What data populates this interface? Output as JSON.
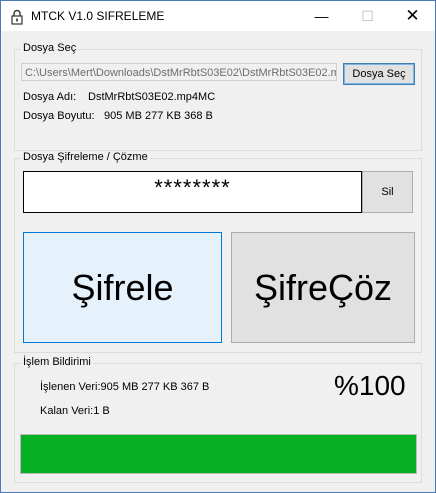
{
  "window": {
    "title": "MTCK V1.0 SIFRELEME",
    "controls": {
      "minimize": "—",
      "maximize": "☐",
      "close": "✕"
    }
  },
  "file_select": {
    "group_label": "Dosya Seç",
    "path_value": "C:\\Users\\Mert\\Downloads\\DstMrRbtS03E02\\DstMrRbtS03E02.m",
    "button_label": "Dosya Seç",
    "name_label": "Dosya Adı:",
    "name_value": "DstMrRbtS03E02.mp4MC",
    "size_label": "Dosya Boyutu:",
    "size_value": "905 MB 277 KB 368 B"
  },
  "crypto": {
    "group_label": "Dosya Şifreleme / Çözme",
    "password_value": "********",
    "clear_label": "Sil",
    "encrypt_label": "Şifrele",
    "decrypt_label": "ŞifreÇöz"
  },
  "status": {
    "group_label": "İşlem Bildirimi",
    "processed_text": "İşlenen Veri:905 MB 277 KB 367 B",
    "remaining_text": "Kalan Veri:1 B",
    "percent_text": "%100",
    "progress_value": 1.0,
    "progress_color": "#06b025"
  }
}
